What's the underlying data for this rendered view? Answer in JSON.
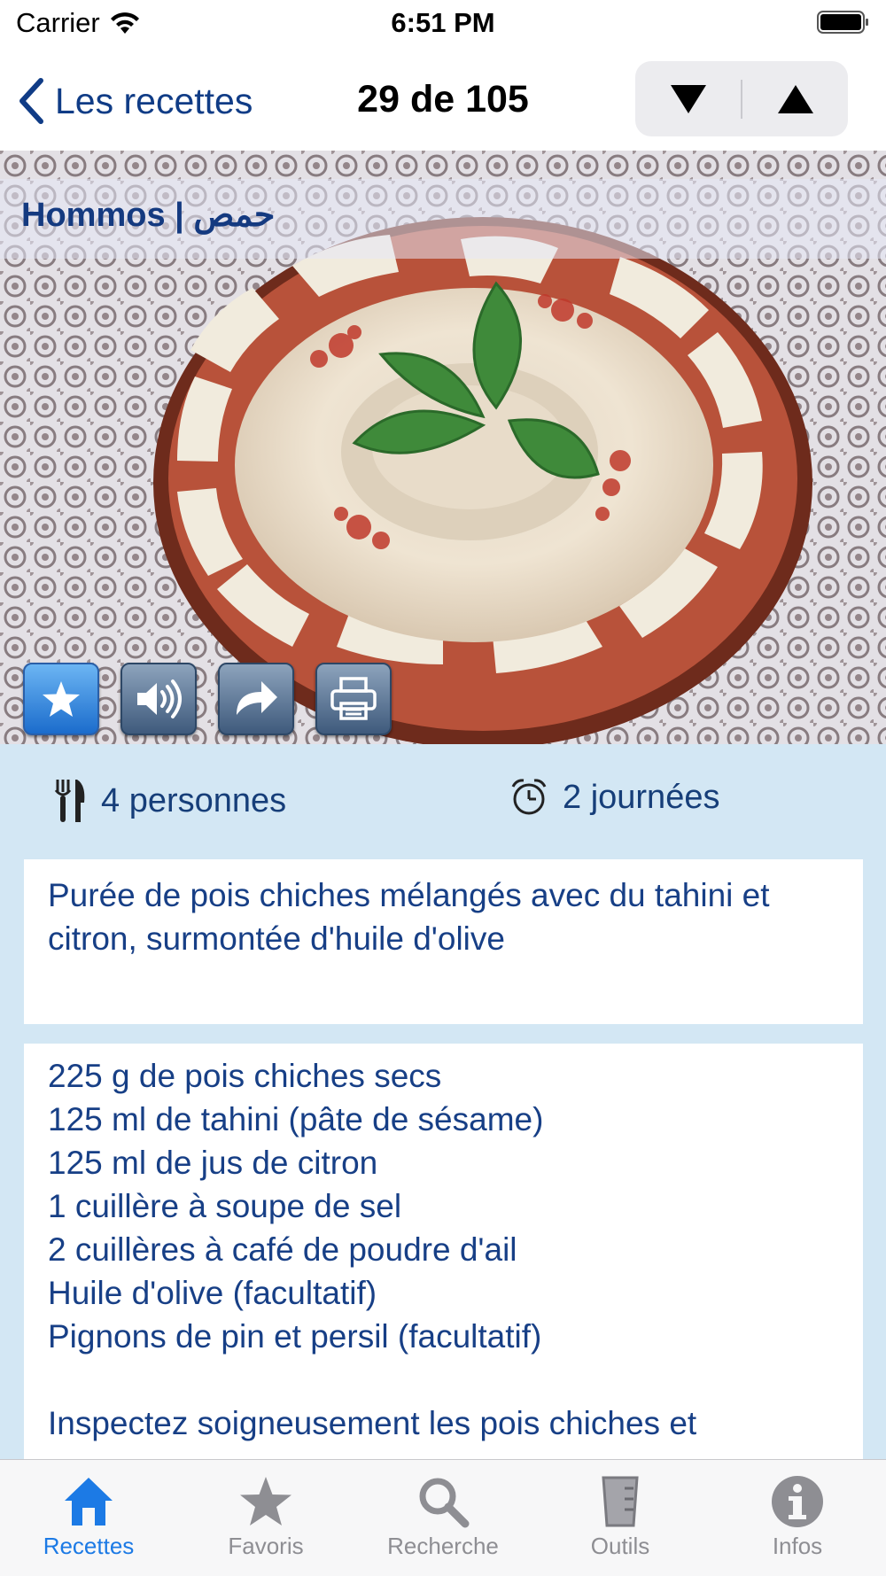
{
  "status_bar": {
    "carrier": "Carrier",
    "time": "6:51 PM"
  },
  "nav": {
    "back_label": "Les recettes",
    "title": "29 de 105",
    "prev_icon": "triangle-down-icon",
    "next_icon": "triangle-up-icon"
  },
  "recipe": {
    "title": "Hommos | حمص",
    "image": "hummus-plate-photo",
    "actions": [
      {
        "name": "favorite-button",
        "icon": "star-icon"
      },
      {
        "name": "audio-button",
        "icon": "speaker-icon"
      },
      {
        "name": "share-button",
        "icon": "share-arrow-icon"
      },
      {
        "name": "print-button",
        "icon": "printer-icon"
      }
    ],
    "servings": "4 personnes",
    "duration": "2 journées",
    "description": "Purée de pois chiches mélangés avec du tahini et citron, surmontée d'huile d'olive",
    "ingredients": [
      "225 g de pois chiches secs",
      "125 ml de tahini (pâte de sésame)",
      "125 ml de jus de citron",
      "1 cuillère à soupe de sel",
      "2 cuillères à café de poudre d'ail",
      "Huile d'olive (facultatif)",
      "Pignons de pin et persil (facultatif)"
    ],
    "instructions_start": "Inspectez soigneusement les pois chiches et"
  },
  "tabs": [
    {
      "label": "Recettes",
      "icon": "house-icon",
      "active": true
    },
    {
      "label": "Favoris",
      "icon": "star-icon",
      "active": false
    },
    {
      "label": "Recherche",
      "icon": "magnifier-icon",
      "active": false
    },
    {
      "label": "Outils",
      "icon": "measuring-cup-icon",
      "active": false
    },
    {
      "label": "Infos",
      "icon": "info-icon",
      "active": false
    }
  ],
  "colors": {
    "accent": "#1c7ae5",
    "title_blue": "#143a80",
    "content_bg": "#d3e7f4",
    "tab_inactive": "#8e8e93"
  }
}
